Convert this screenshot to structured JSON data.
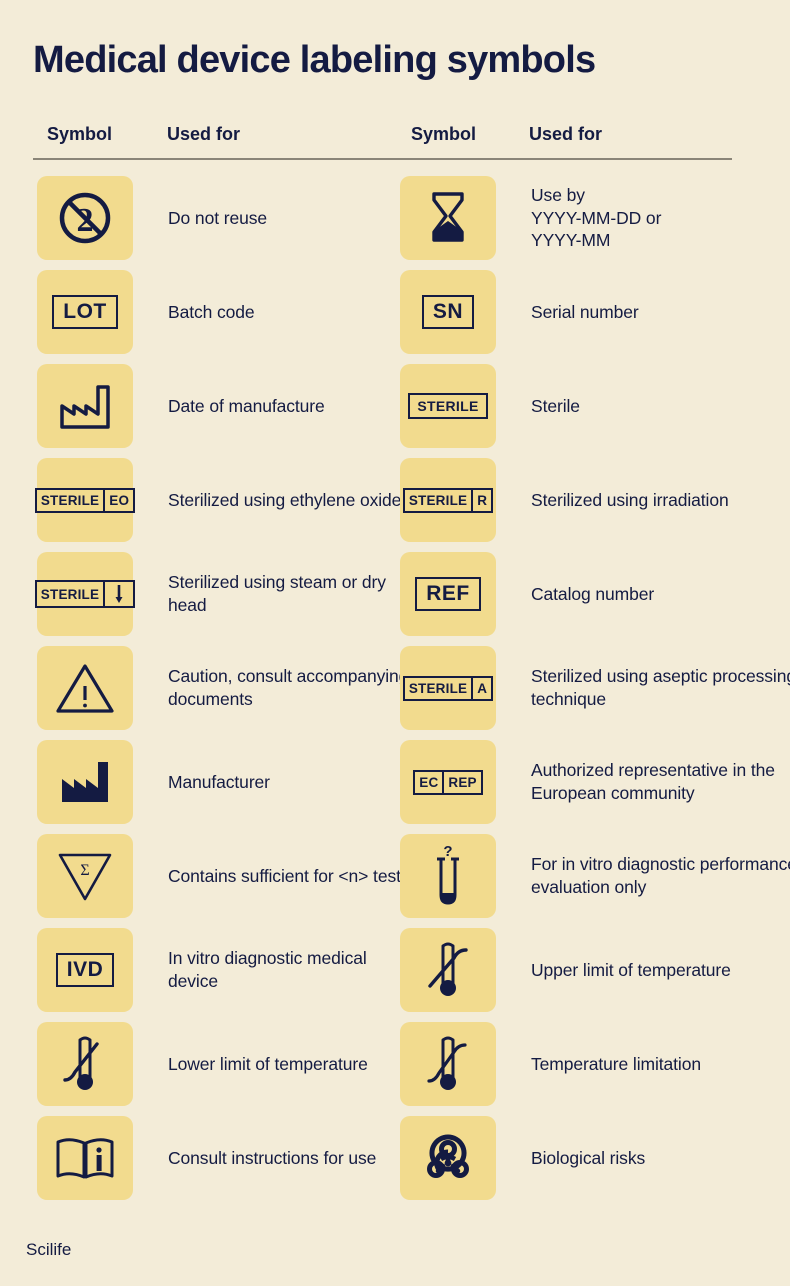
{
  "page": {
    "title": "Medical device labeling symbols",
    "footer": "Scilife",
    "background_color": "#F3ECD8",
    "tile_color": "#F2DB8E",
    "ink_color": "#141B42"
  },
  "table": {
    "headers": [
      "Symbol",
      "Used for",
      "Symbol",
      "Used for"
    ],
    "left_column": [
      {
        "icon": "do-not-reuse-icon",
        "symbol_text": "",
        "used_for": "Do not reuse"
      },
      {
        "icon": "lot-box-icon",
        "symbol_text": "LOT",
        "used_for": "Batch code"
      },
      {
        "icon": "factory-outline-icon",
        "symbol_text": "",
        "used_for": "Date of manufacture"
      },
      {
        "icon": "sterile-eo-box-icon",
        "symbol_text": "STERILE EO",
        "used_for": "Sterilized using ethylene oxide"
      },
      {
        "icon": "sterile-steam-box-icon",
        "symbol_text": "STERILE",
        "used_for": "Sterilized using steam or dry head"
      },
      {
        "icon": "caution-triangle-icon",
        "symbol_text": "",
        "used_for": "Caution, consult accompanying documents"
      },
      {
        "icon": "factory-solid-icon",
        "symbol_text": "",
        "used_for": "Manufacturer"
      },
      {
        "icon": "sigma-triangle-icon",
        "symbol_text": "",
        "used_for": "Contains sufficient for <n> tests"
      },
      {
        "icon": "ivd-box-icon",
        "symbol_text": "IVD",
        "used_for": "In vitro diagnostic medical device"
      },
      {
        "icon": "thermometer-lower-limit-icon",
        "symbol_text": "",
        "used_for": "Lower limit of temperature"
      },
      {
        "icon": "instructions-booklet-icon",
        "symbol_text": "",
        "used_for": "Consult instructions for use"
      }
    ],
    "right_column": [
      {
        "icon": "hourglass-icon",
        "symbol_text": "",
        "used_for": "Use by\nYYYY-MM-DD or\nYYYY-MM"
      },
      {
        "icon": "sn-box-icon",
        "symbol_text": "SN",
        "used_for": "Serial number"
      },
      {
        "icon": "sterile-box-icon",
        "symbol_text": "STERILE",
        "used_for": "Sterile"
      },
      {
        "icon": "sterile-r-box-icon",
        "symbol_text": "STERILE R",
        "used_for": "Sterilized using irradiation"
      },
      {
        "icon": "ref-box-icon",
        "symbol_text": "REF",
        "used_for": "Catalog number"
      },
      {
        "icon": "sterile-a-box-icon",
        "symbol_text": "STERILE A",
        "used_for": "Sterilized using aseptic processing technique"
      },
      {
        "icon": "ec-rep-box-icon",
        "symbol_text": "EC REP",
        "used_for": "Authorized representative in the European community"
      },
      {
        "icon": "test-tube-question-icon",
        "symbol_text": "",
        "used_for": "For in vitro diagnostic performance evaluation only"
      },
      {
        "icon": "thermometer-upper-limit-icon",
        "symbol_text": "",
        "used_for": "Upper limit of temperature"
      },
      {
        "icon": "thermometer-range-icon",
        "symbol_text": "",
        "used_for": "Temperature limitation"
      },
      {
        "icon": "biohazard-icon",
        "symbol_text": "Biological risks",
        "used_for": "Biological risks"
      }
    ]
  },
  "box_labels": {
    "lot": "LOT",
    "sn": "SN",
    "ref": "REF",
    "ivd": "IVD",
    "sterile": "STERILE",
    "eo": "EO",
    "r": "R",
    "a": "A",
    "ec": "EC",
    "rep": "REP"
  }
}
